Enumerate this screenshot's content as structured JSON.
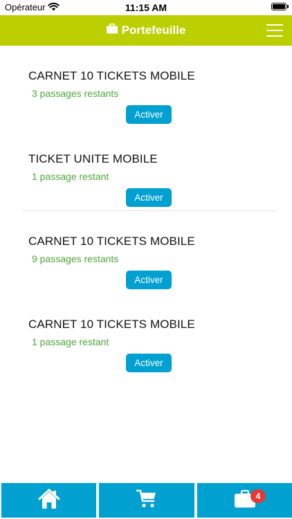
{
  "status_bar": {
    "carrier": "Opérateur",
    "time": "11:15 AM",
    "wifi_icon": "wifi-icon",
    "battery_icon": "battery-icon"
  },
  "header": {
    "title": "Portefeuille",
    "title_icon": "briefcase-icon",
    "menu_icon": "hamburger-menu-icon",
    "background_color": "#bccf00"
  },
  "tickets": [
    {
      "name": "CARNET 10 TICKETS MOBILE",
      "remaining": "3 passages restants",
      "button_label": "Activer"
    },
    {
      "name": "TICKET UNITE MOBILE",
      "remaining": "1 passage restant",
      "button_label": "Activer"
    },
    {
      "name": "CARNET 10 TICKETS MOBILE",
      "remaining": "9 passages restants",
      "button_label": "Activer"
    },
    {
      "name": "CARNET 10 TICKETS MOBILE",
      "remaining": "1 passage restant",
      "button_label": "Activer"
    }
  ],
  "tab_bar": {
    "tabs": [
      {
        "icon": "home-icon"
      },
      {
        "icon": "cart-icon"
      },
      {
        "icon": "wallet-icon",
        "badge": "4"
      }
    ],
    "background_color": "#00a0d1",
    "badge_color": "#e53935"
  },
  "colors": {
    "accent_button": "#00a0d1",
    "remaining_text": "#4fa53c"
  }
}
